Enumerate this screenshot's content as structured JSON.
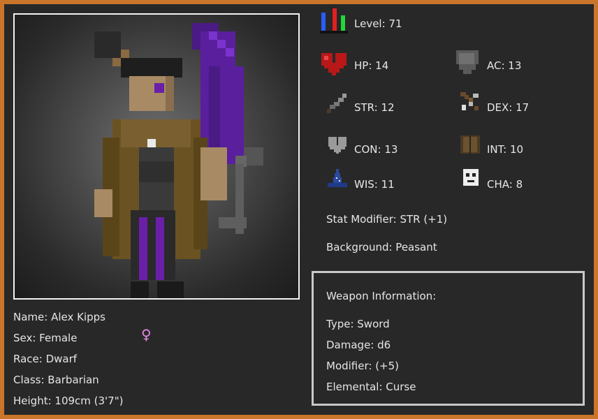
{
  "character": {
    "name": "Name: Alex Kipps",
    "sex": "Sex: Female",
    "sex_symbol": "♀",
    "race": "Race: Dwarf",
    "class": "Class: Barbarian",
    "height": "Height: 109cm (3'7\")"
  },
  "stats": {
    "level": "Level: 71",
    "hp": "HP: 14",
    "ac": "AC: 13",
    "str": "STR: 12",
    "dex": "DEX: 17",
    "con": "CON: 13",
    "int": "INT: 10",
    "wis": "WIS: 11",
    "cha": "CHA: 8",
    "stat_modifier": "Stat Modifier: STR (+1)",
    "background": "Background: Peasant"
  },
  "weapon": {
    "header": "Weapon Information:",
    "type": "Type: Sword",
    "damage": "Damage: d6",
    "modifier": "Modifier: (+5)",
    "elemental": "Elemental: Curse"
  },
  "colors": {
    "frame": "#c9752a",
    "panel": "#282828",
    "text": "#e6e6e6",
    "weapon_purple": "#5b1a9e",
    "sex_symbol": "#e58ae0"
  },
  "icons": {
    "level": "level-bars-icon",
    "hp": "heart-icon",
    "ac": "shield-icon",
    "str": "sword-icon",
    "dex": "crossbow-icon",
    "con": "grey-heart-icon",
    "int": "book-icon",
    "wis": "wizard-hat-icon",
    "cha": "mask-icon"
  }
}
